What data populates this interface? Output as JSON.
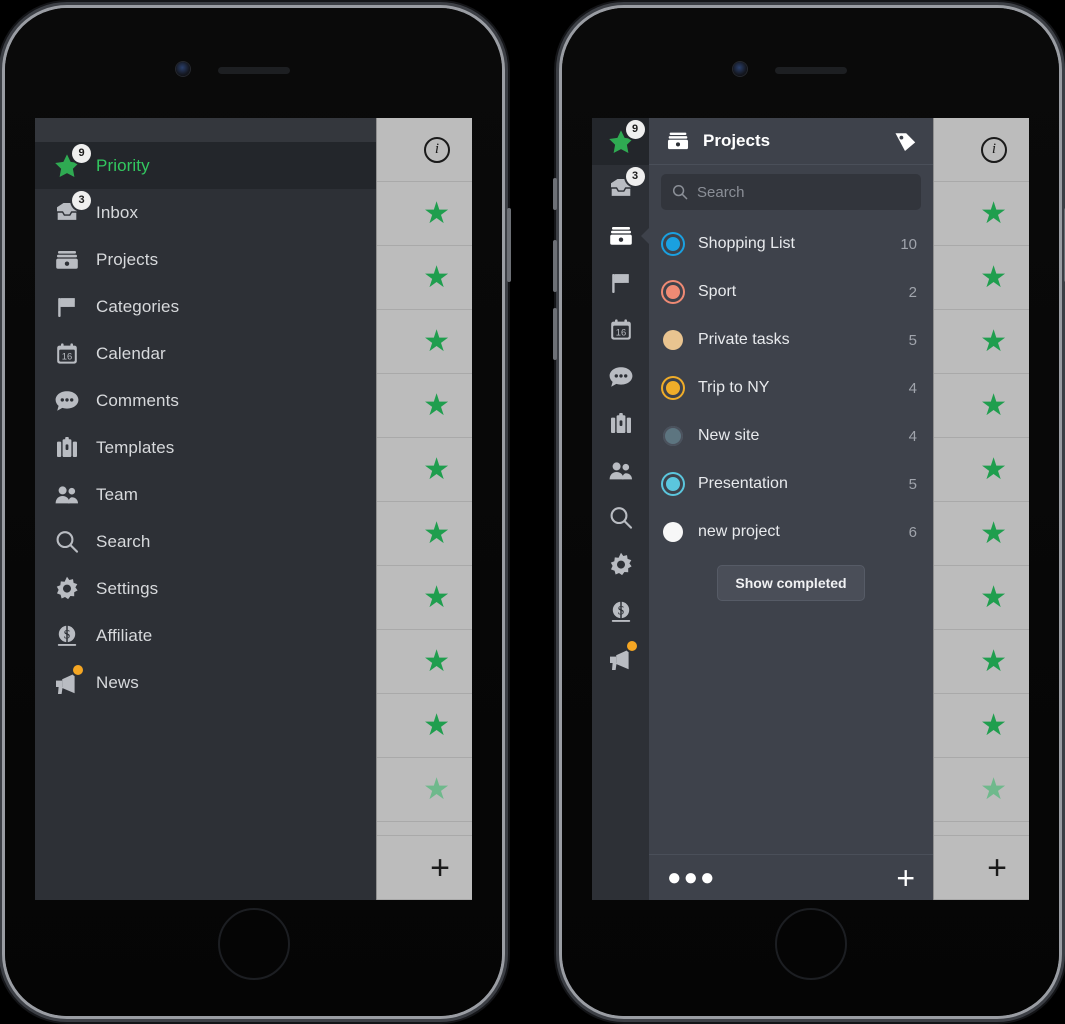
{
  "app": {
    "accent_green": "#32c75f",
    "star_green": "#1f9e4e",
    "menu_bg": "#2d3036",
    "active_bg": "#23262b",
    "panel_bg": "#3e424b",
    "star_col_bg": "#bcbcbc",
    "badge_dot": "#f5a623"
  },
  "left_phone": {
    "menu": {
      "items": [
        {
          "label": "Priority",
          "icon": "star-icon",
          "badge": "9",
          "active": true,
          "dot": false
        },
        {
          "label": "Inbox",
          "icon": "inbox-icon",
          "badge": "3",
          "active": false,
          "dot": false
        },
        {
          "label": "Projects",
          "icon": "projects-icon",
          "badge": "",
          "active": false,
          "dot": false
        },
        {
          "label": "Categories",
          "icon": "flag-icon",
          "badge": "",
          "active": false,
          "dot": false
        },
        {
          "label": "Calendar",
          "icon": "calendar-icon",
          "badge": "",
          "active": false,
          "dot": false
        },
        {
          "label": "Comments",
          "icon": "comments-icon",
          "badge": "",
          "active": false,
          "dot": false
        },
        {
          "label": "Templates",
          "icon": "templates-icon",
          "badge": "",
          "active": false,
          "dot": false
        },
        {
          "label": "Team",
          "icon": "team-icon",
          "badge": "",
          "active": false,
          "dot": false
        },
        {
          "label": "Search",
          "icon": "search-icon",
          "badge": "",
          "active": false,
          "dot": false
        },
        {
          "label": "Settings",
          "icon": "gear-icon",
          "badge": "",
          "active": false,
          "dot": false
        },
        {
          "label": "Affiliate",
          "icon": "dollar-icon",
          "badge": "",
          "active": false,
          "dot": false
        },
        {
          "label": "News",
          "icon": "megaphone-icon",
          "badge": "",
          "active": false,
          "dot": true
        }
      ]
    },
    "star_column": {
      "info_label": "i",
      "plus_label": "+",
      "rows": [
        {
          "type": "info"
        },
        {
          "type": "star",
          "faded": false
        },
        {
          "type": "star",
          "faded": false
        },
        {
          "type": "star",
          "faded": false
        },
        {
          "type": "star",
          "faded": false
        },
        {
          "type": "star",
          "faded": false
        },
        {
          "type": "star",
          "faded": false
        },
        {
          "type": "star",
          "faded": false
        },
        {
          "type": "star",
          "faded": false
        },
        {
          "type": "star",
          "faded": false
        },
        {
          "type": "star",
          "faded": true
        },
        {
          "type": "blank"
        },
        {
          "type": "plus"
        }
      ]
    }
  },
  "right_phone": {
    "rail": {
      "items": [
        {
          "icon": "star-icon",
          "badge": "9",
          "active": true,
          "current": false,
          "dot": false
        },
        {
          "icon": "inbox-icon",
          "badge": "3",
          "active": false,
          "current": false,
          "dot": false
        },
        {
          "icon": "projects-icon",
          "badge": "",
          "active": false,
          "current": true,
          "dot": false
        },
        {
          "icon": "flag-icon",
          "badge": "",
          "active": false,
          "current": false,
          "dot": false
        },
        {
          "icon": "calendar-icon",
          "badge": "",
          "active": false,
          "current": false,
          "dot": false
        },
        {
          "icon": "comments-icon",
          "badge": "",
          "active": false,
          "current": false,
          "dot": false
        },
        {
          "icon": "templates-icon",
          "badge": "",
          "active": false,
          "current": false,
          "dot": false
        },
        {
          "icon": "team-icon",
          "badge": "",
          "active": false,
          "current": false,
          "dot": false
        },
        {
          "icon": "search-icon",
          "badge": "",
          "active": false,
          "current": false,
          "dot": false
        },
        {
          "icon": "gear-icon",
          "badge": "",
          "active": false,
          "current": false,
          "dot": false
        },
        {
          "icon": "dollar-icon",
          "badge": "",
          "active": false,
          "current": false,
          "dot": false
        },
        {
          "icon": "megaphone-icon",
          "badge": "",
          "active": false,
          "current": false,
          "dot": true
        }
      ]
    },
    "projects": {
      "header_title": "Projects",
      "header_icon": "projects-icon",
      "tag_icon": "tag-icon",
      "search_placeholder": "Search",
      "search_value": "",
      "items": [
        {
          "name": "Shopping List",
          "count": "10",
          "color": "#1aa0e0",
          "style": "ring"
        },
        {
          "name": "Sport",
          "count": "2",
          "color": "#ef8a74",
          "style": "ring"
        },
        {
          "name": "Private tasks",
          "count": "5",
          "color": "#e9c490",
          "style": "solid"
        },
        {
          "name": "Trip to NY",
          "count": "4",
          "color": "#f0ad29",
          "style": "ring"
        },
        {
          "name": "New site",
          "count": "4",
          "color": "#5d7580",
          "style": "solid-ring"
        },
        {
          "name": "Presentation",
          "count": "5",
          "color": "#5bc6dd",
          "style": "ring"
        },
        {
          "name": "new project",
          "count": "6",
          "color": "#f7f7f7",
          "style": "solid"
        }
      ],
      "show_completed_label": "Show completed",
      "toolbar": {
        "more_label": "●●●",
        "add_label": "+"
      }
    },
    "star_column": {
      "info_label": "i",
      "plus_label": "+",
      "rows": [
        {
          "type": "info"
        },
        {
          "type": "star",
          "faded": false
        },
        {
          "type": "star",
          "faded": false
        },
        {
          "type": "star",
          "faded": false
        },
        {
          "type": "star",
          "faded": false
        },
        {
          "type": "star",
          "faded": false
        },
        {
          "type": "star",
          "faded": false
        },
        {
          "type": "star",
          "faded": false
        },
        {
          "type": "star",
          "faded": false
        },
        {
          "type": "star",
          "faded": false
        },
        {
          "type": "star",
          "faded": true
        },
        {
          "type": "blank"
        },
        {
          "type": "plus"
        }
      ]
    }
  }
}
